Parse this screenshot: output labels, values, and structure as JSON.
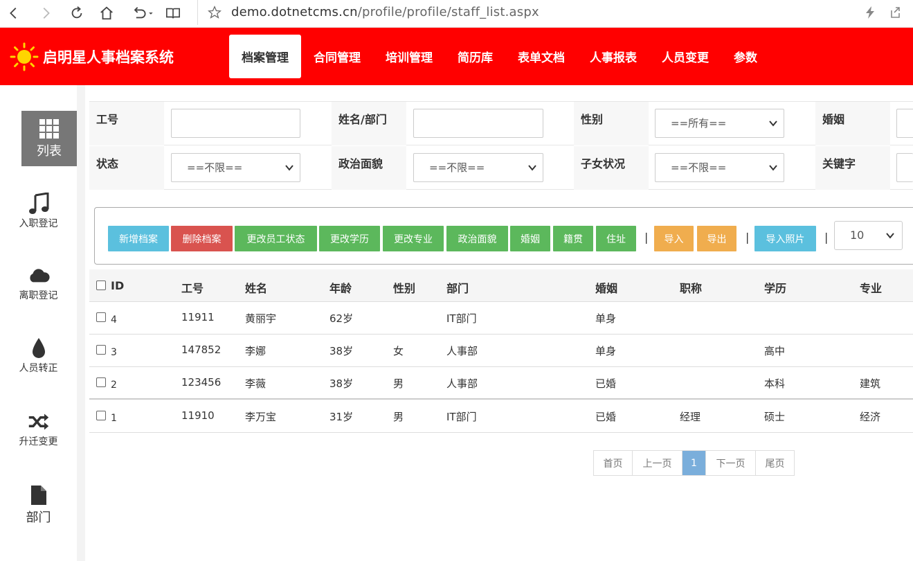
{
  "browser": {
    "url_host": "demo.dotnetcms.cn",
    "url_path": "/profile/profile/staff_list.aspx"
  },
  "header": {
    "title": "启明星人事档案系统",
    "brand_color": "#ff0000",
    "tabs": [
      {
        "label": "档案管理",
        "active": true
      },
      {
        "label": "合同管理"
      },
      {
        "label": "培训管理"
      },
      {
        "label": "简历库"
      },
      {
        "label": "表单文档"
      },
      {
        "label": "人事报表"
      },
      {
        "label": "人员变更"
      },
      {
        "label": "参数"
      }
    ]
  },
  "sidebar": {
    "items": [
      {
        "label": "列表",
        "icon": "grid-icon",
        "active": true
      },
      {
        "label": "入职登记",
        "icon": "music-note-icon"
      },
      {
        "label": "离职登记",
        "icon": "cloud-icon"
      },
      {
        "label": "人员转正",
        "icon": "drop-icon"
      },
      {
        "label": "升迁变更",
        "icon": "shuffle-icon"
      },
      {
        "label": "部门",
        "icon": "file-icon"
      }
    ]
  },
  "filters": {
    "row1": {
      "staff_no_label": "工号",
      "name_dept_label": "姓名/部门",
      "gender_label": "性别",
      "gender_value": "==所有==",
      "marriage_label": "婚姻"
    },
    "row2": {
      "status_label": "状态",
      "status_value": "==不限==",
      "politics_label": "政治面貌",
      "politics_value": "==不限==",
      "children_label": "子女状况",
      "children_value": "==不限==",
      "keyword_label": "关键字"
    }
  },
  "toolbar": {
    "add": "新增档案",
    "delete": "删除档案",
    "change_status": "更改员工状态",
    "change_edu": "更改学历",
    "change_major": "更改专业",
    "politics": "政治面貌",
    "marriage": "婚姻",
    "origin": "籍贯",
    "address": "住址",
    "import": "导入",
    "export": "导出",
    "import_photo": "导入照片",
    "page_size": "10",
    "sep": "|"
  },
  "table": {
    "columns": {
      "id": "ID",
      "staff_no": "工号",
      "name": "姓名",
      "age": "年龄",
      "gender": "性别",
      "dept": "部门",
      "marriage": "婚姻",
      "title": "职称",
      "edu": "学历",
      "major": "专业"
    },
    "rows": [
      {
        "id": "4",
        "staff_no": "11911",
        "name": "黄丽宇",
        "age": "62岁",
        "gender": "",
        "dept": "IT部门",
        "marriage": "单身",
        "title": "",
        "edu": "",
        "major": ""
      },
      {
        "id": "3",
        "staff_no": "147852",
        "name": "李娜",
        "age": "38岁",
        "gender": "女",
        "dept": "人事部",
        "marriage": "单身",
        "title": "",
        "edu": "高中",
        "major": ""
      },
      {
        "id": "2",
        "staff_no": "123456",
        "name": "李薇",
        "age": "38岁",
        "gender": "男",
        "dept": "人事部",
        "marriage": "已婚",
        "title": "",
        "edu": "本科",
        "major": "建筑"
      },
      {
        "id": "1",
        "staff_no": "11910",
        "name": "李万宝",
        "age": "31岁",
        "gender": "男",
        "dept": "IT部门",
        "marriage": "已婚",
        "title": "经理",
        "edu": "硕士",
        "major": "经济"
      }
    ]
  },
  "pager": {
    "first": "首页",
    "prev": "上一页",
    "current": "1",
    "next": "下一页",
    "last": "尾页"
  }
}
